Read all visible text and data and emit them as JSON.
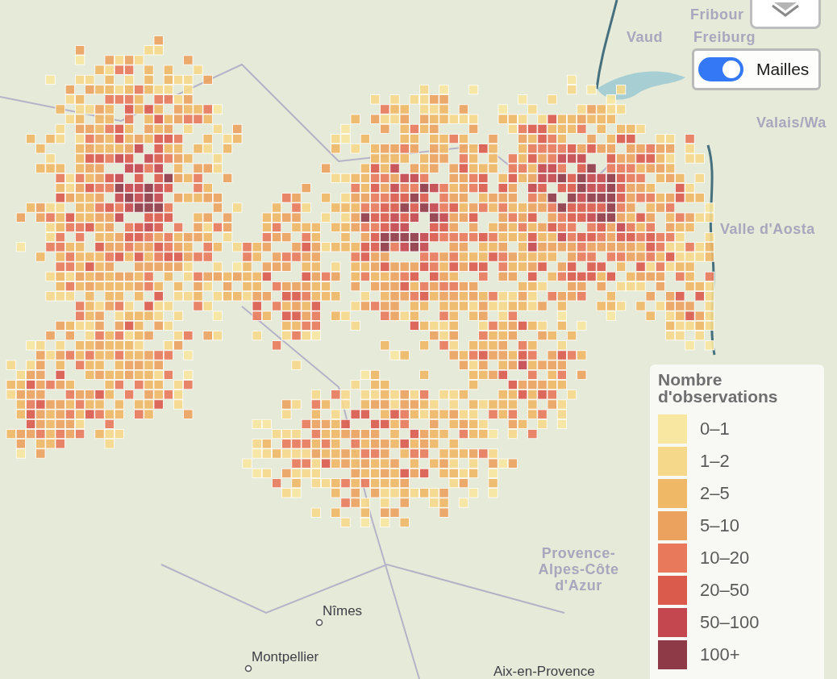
{
  "map": {
    "labels": [
      {
        "text": "Fribour",
        "kind": "region"
      },
      {
        "text": "Vaud",
        "kind": "region"
      },
      {
        "text": "Freiburg",
        "kind": "region"
      },
      {
        "text": "Valais/Wa",
        "kind": "region"
      },
      {
        "text": "Valle d'Aosta",
        "kind": "region"
      },
      {
        "text": "Provence-Alpes-Côte d'Azur",
        "kind": "region"
      },
      {
        "text": "Nîmes",
        "kind": "city"
      },
      {
        "text": "Montpellier",
        "kind": "city"
      },
      {
        "text": "Aix-en-Provence",
        "kind": "city"
      }
    ]
  },
  "toggle": {
    "label": "Mailles",
    "on": true
  },
  "legend": {
    "title": "Nombre d'observations",
    "items": [
      {
        "label": "0–1",
        "color": "#f7e7a0"
      },
      {
        "label": "1–2",
        "color": "#f5d88a"
      },
      {
        "label": "2–5",
        "color": "#efb866"
      },
      {
        "label": "5–10",
        "color": "#eba25e"
      },
      {
        "label": "10–20",
        "color": "#e8795a"
      },
      {
        "label": "20–50",
        "color": "#da5a4c"
      },
      {
        "label": "50–100",
        "color": "#c4474f"
      },
      {
        "label": "100+",
        "color": "#8f3a47"
      }
    ]
  }
}
